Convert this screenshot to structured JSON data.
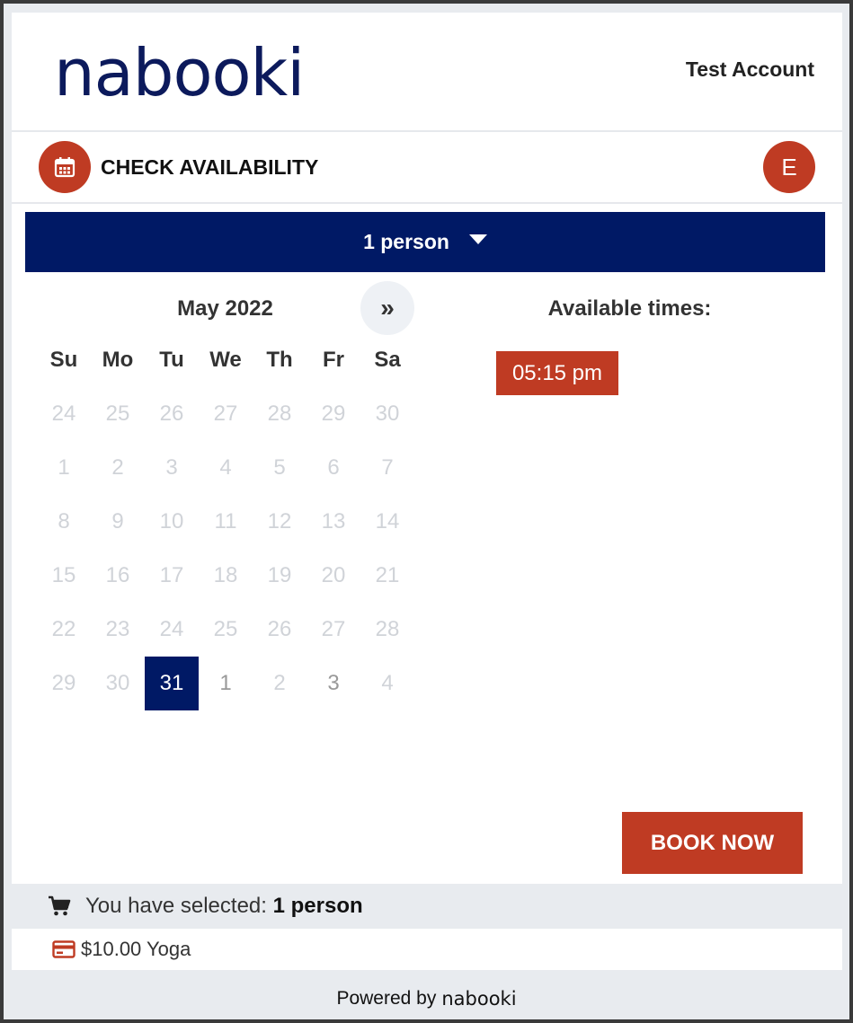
{
  "header": {
    "logo_text": "nabooki",
    "account_name": "Test Account"
  },
  "check_availability": {
    "title": "CHECK AVAILABILITY",
    "avatar_initial": "E",
    "icon": "calendar-icon"
  },
  "person_select": {
    "label": "1 person"
  },
  "calendar": {
    "month_label": "May 2022",
    "next_label": "»",
    "weekdays": [
      "Su",
      "Mo",
      "Tu",
      "We",
      "Th",
      "Fr",
      "Sa"
    ],
    "weeks": [
      [
        {
          "d": "24",
          "s": "disabled"
        },
        {
          "d": "25",
          "s": "disabled"
        },
        {
          "d": "26",
          "s": "disabled"
        },
        {
          "d": "27",
          "s": "disabled"
        },
        {
          "d": "28",
          "s": "disabled"
        },
        {
          "d": "29",
          "s": "disabled"
        },
        {
          "d": "30",
          "s": "disabled"
        }
      ],
      [
        {
          "d": "1",
          "s": "disabled"
        },
        {
          "d": "2",
          "s": "disabled"
        },
        {
          "d": "3",
          "s": "disabled"
        },
        {
          "d": "4",
          "s": "disabled"
        },
        {
          "d": "5",
          "s": "disabled"
        },
        {
          "d": "6",
          "s": "disabled"
        },
        {
          "d": "7",
          "s": "disabled"
        }
      ],
      [
        {
          "d": "8",
          "s": "disabled"
        },
        {
          "d": "9",
          "s": "disabled"
        },
        {
          "d": "10",
          "s": "disabled"
        },
        {
          "d": "11",
          "s": "disabled"
        },
        {
          "d": "12",
          "s": "disabled"
        },
        {
          "d": "13",
          "s": "disabled"
        },
        {
          "d": "14",
          "s": "disabled"
        }
      ],
      [
        {
          "d": "15",
          "s": "disabled"
        },
        {
          "d": "16",
          "s": "disabled"
        },
        {
          "d": "17",
          "s": "disabled"
        },
        {
          "d": "18",
          "s": "disabled"
        },
        {
          "d": "19",
          "s": "disabled"
        },
        {
          "d": "20",
          "s": "disabled"
        },
        {
          "d": "21",
          "s": "disabled"
        }
      ],
      [
        {
          "d": "22",
          "s": "disabled"
        },
        {
          "d": "23",
          "s": "disabled"
        },
        {
          "d": "24",
          "s": "disabled"
        },
        {
          "d": "25",
          "s": "disabled"
        },
        {
          "d": "26",
          "s": "disabled"
        },
        {
          "d": "27",
          "s": "disabled"
        },
        {
          "d": "28",
          "s": "disabled"
        }
      ],
      [
        {
          "d": "29",
          "s": "disabled"
        },
        {
          "d": "30",
          "s": "disabled"
        },
        {
          "d": "31",
          "s": "selected"
        },
        {
          "d": "1",
          "s": "avail"
        },
        {
          "d": "2",
          "s": "disabled"
        },
        {
          "d": "3",
          "s": "avail"
        },
        {
          "d": "4",
          "s": "disabled"
        }
      ]
    ]
  },
  "times": {
    "title": "Available times:",
    "slots": [
      "05:15 pm"
    ]
  },
  "book_button": "BOOK NOW",
  "summary": {
    "prefix": "You have selected: ",
    "selection": "1 person"
  },
  "price_line": "$10.00 Yoga",
  "footer": {
    "powered_by": "Powered by",
    "brand": "nabooki"
  },
  "colors": {
    "navy": "#001965",
    "accent": "#bf3b23"
  }
}
